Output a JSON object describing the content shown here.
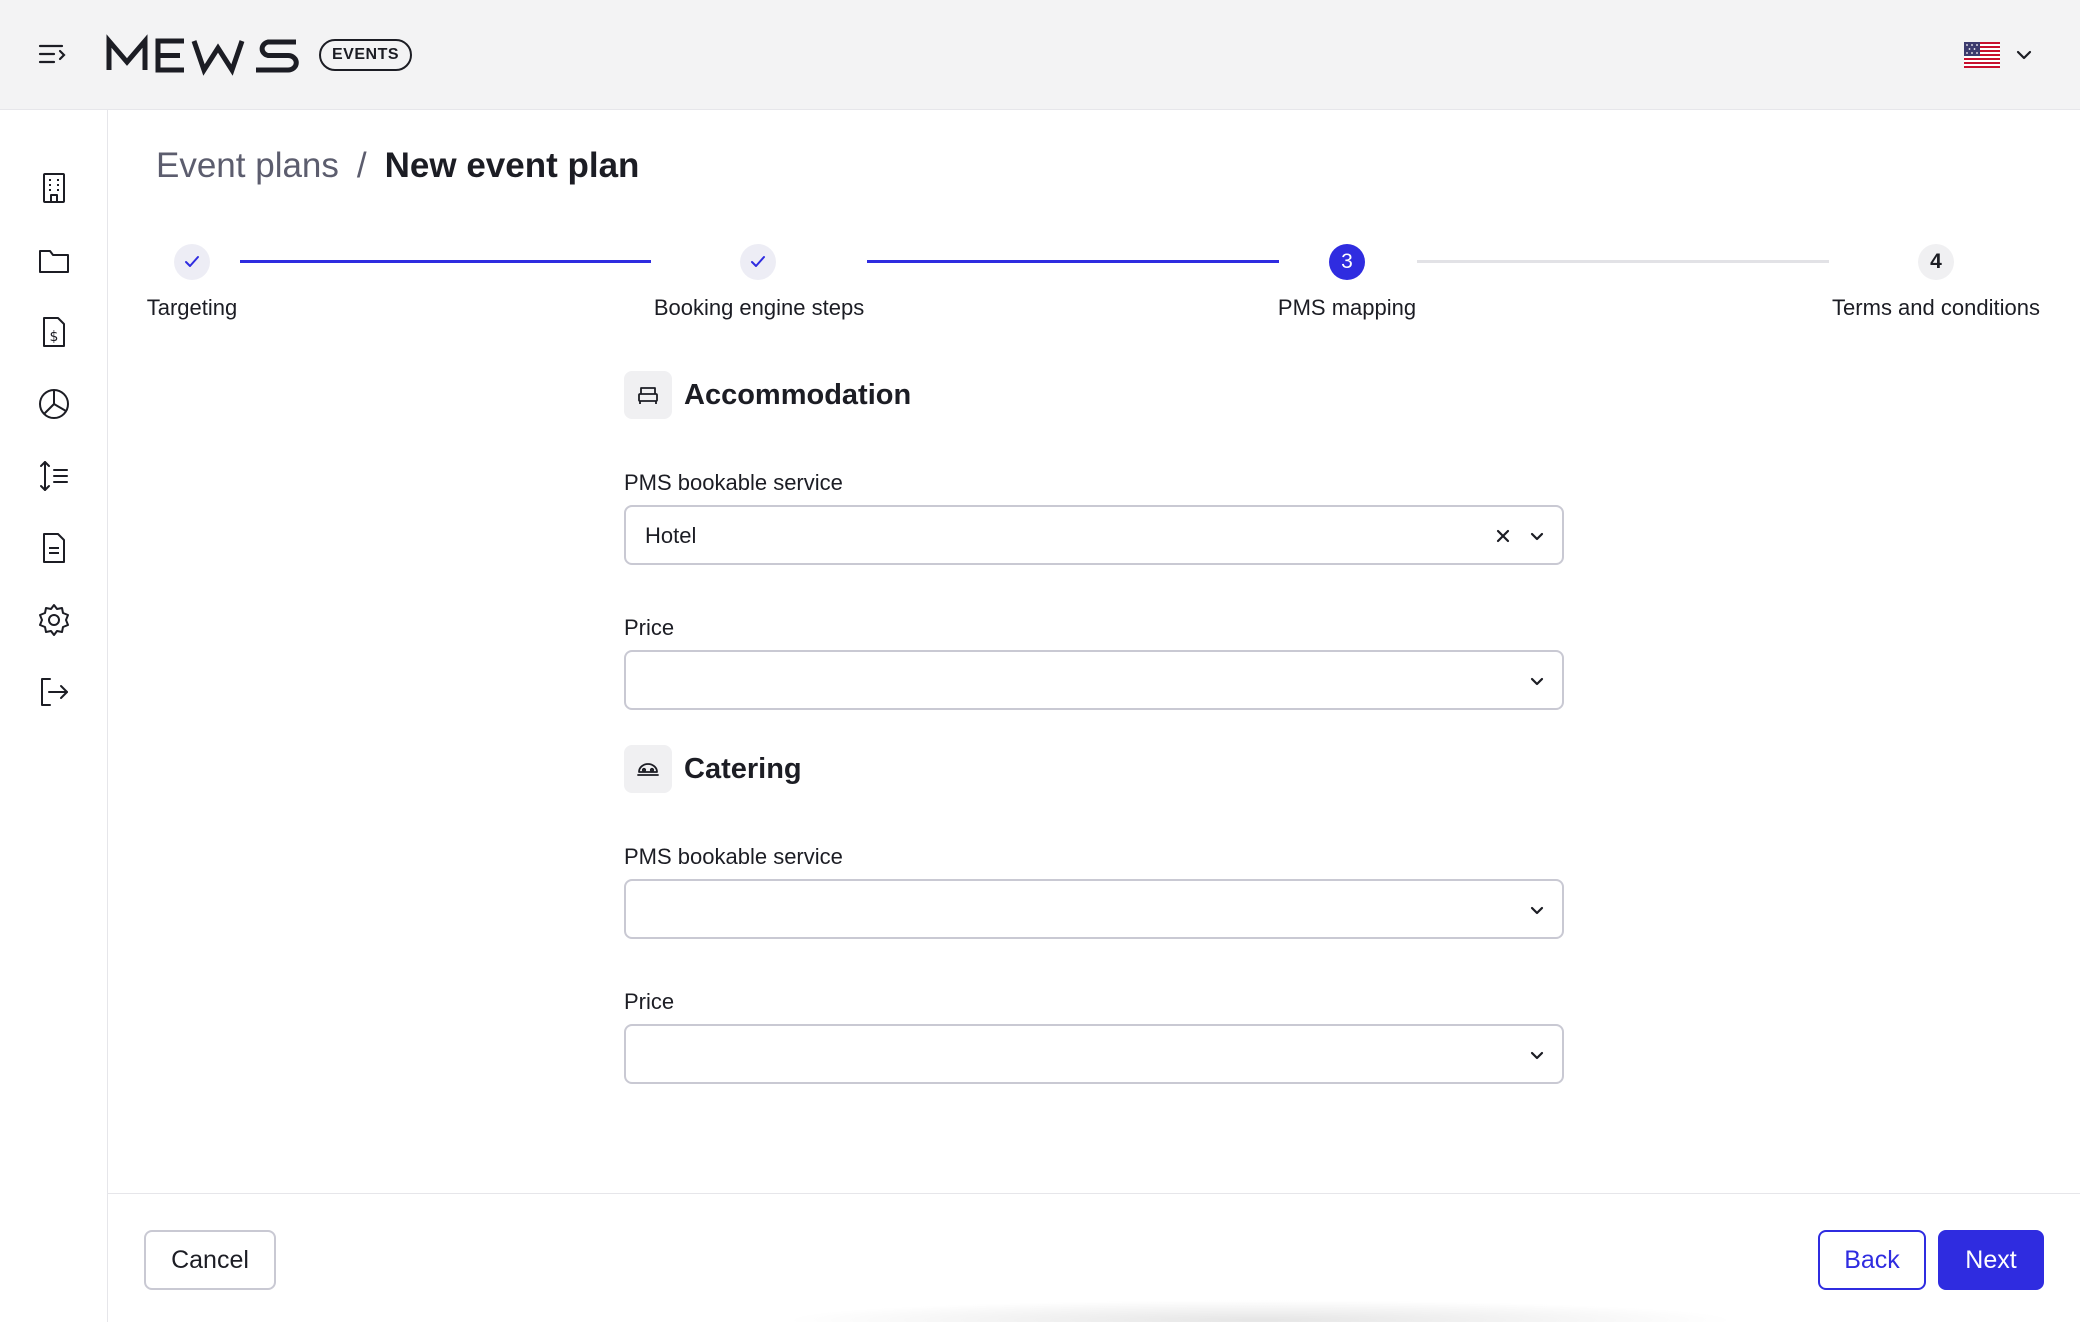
{
  "app": {
    "logo_text": "MEWS",
    "badge": "EVENTS"
  },
  "header": {
    "language_flag": "us-flag-icon"
  },
  "sidebar": {
    "icons": [
      "building-icon",
      "folder-icon",
      "invoice-dollar-icon",
      "pie-chart-icon",
      "sort-list-icon",
      "document-icon",
      "gear-icon",
      "logout-icon"
    ]
  },
  "breadcrumb": {
    "parent": "Event plans",
    "separator": "/",
    "current": "New event plan"
  },
  "stepper": {
    "steps": [
      {
        "label": "Targeting",
        "status": "done",
        "marker": "✓"
      },
      {
        "label": "Booking engine steps",
        "status": "done",
        "marker": "✓"
      },
      {
        "label": "PMS mapping",
        "status": "active",
        "marker": "3"
      },
      {
        "label": "Terms and conditions",
        "status": "todo",
        "marker": "4"
      }
    ]
  },
  "sections": {
    "accommodation": {
      "title": "Accommodation",
      "icon": "bed-icon",
      "service_label": "PMS bookable service",
      "service_value": "Hotel",
      "price_label": "Price",
      "price_value": ""
    },
    "catering": {
      "title": "Catering",
      "icon": "catering-icon",
      "service_label": "PMS bookable service",
      "service_value": "",
      "price_label": "Price",
      "price_value": ""
    }
  },
  "footer": {
    "cancel_label": "Cancel",
    "back_label": "Back",
    "next_label": "Next"
  },
  "colors": {
    "accent": "#2f2ce0",
    "topbar": "#f3f3f4",
    "border": "#c9c9d3",
    "text": "#1c1d24",
    "muted": "#5c5d6e"
  }
}
